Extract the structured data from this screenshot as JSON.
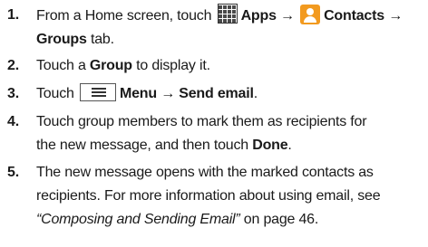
{
  "steps": [
    {
      "number": "1.",
      "line1_a": "From a Home screen, touch",
      "apps_icon": "apps-grid-icon",
      "apps_label": "Apps",
      "arrow1": "→",
      "contacts_icon": "contacts-person-icon",
      "contacts_label": "Contacts",
      "arrow2": "→",
      "groups_label": "Groups",
      "tail": "tab."
    },
    {
      "number": "2.",
      "pre": "Touch a",
      "group_label": "Group",
      "post": "to display it."
    },
    {
      "number": "3.",
      "pre": "Touch",
      "menu_icon": "menu-icon",
      "menu_label": "Menu",
      "arrow": "→",
      "send_label": "Send email",
      "tail": "."
    },
    {
      "number": "4.",
      "line1": "Touch group members to mark them as recipients for",
      "line2_pre": "the new message, and then touch",
      "done_label": "Done",
      "tail": "."
    },
    {
      "number": "5.",
      "line1": "The new message opens with the marked contacts as",
      "line2": "recipients. For more information about using email, see",
      "ref_title": "“Composing and Sending Email”",
      "ref_tail": "on page 46."
    }
  ],
  "colors": {
    "text": "#1a1a1a",
    "contacts_icon_bg": "#f29a1f"
  }
}
